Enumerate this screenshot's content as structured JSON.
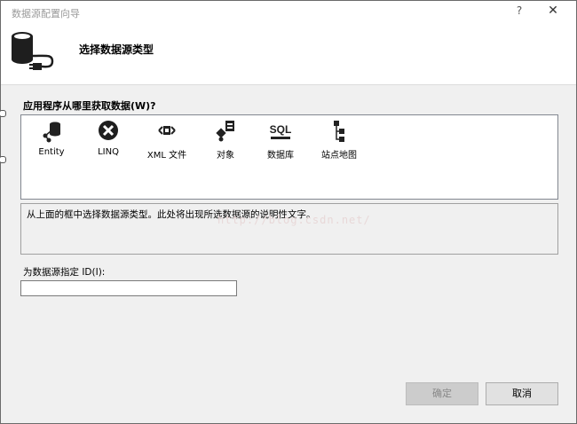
{
  "window": {
    "title": "数据源配置向导",
    "help_label": "?",
    "close_label": "✕"
  },
  "header": {
    "title": "选择数据源类型",
    "icon": "database-plug-icon"
  },
  "question": {
    "label": "应用程序从哪里获取数据(W)?"
  },
  "data_sources": [
    {
      "label": "Entity",
      "icon": "entity-icon"
    },
    {
      "label": "LINQ",
      "icon": "linq-icon"
    },
    {
      "label": "XML 文件",
      "icon": "xml-file-icon"
    },
    {
      "label": "对象",
      "icon": "object-icon"
    },
    {
      "label": "数据库",
      "icon": "sql-database-icon"
    },
    {
      "label": "站点地图",
      "icon": "sitemap-icon"
    }
  ],
  "description": {
    "text": "从上面的框中选择数据源类型。此处将出现所选数据源的说明性文字。"
  },
  "watermark": "http://blog.csdn.net/",
  "id_field": {
    "label": "为数据源指定 ID(I):",
    "value": ""
  },
  "buttons": {
    "ok": "确定",
    "cancel": "取消"
  },
  "colors": {
    "dialog_bg": "#f0f0f0",
    "disabled_button": "#cccccc"
  }
}
